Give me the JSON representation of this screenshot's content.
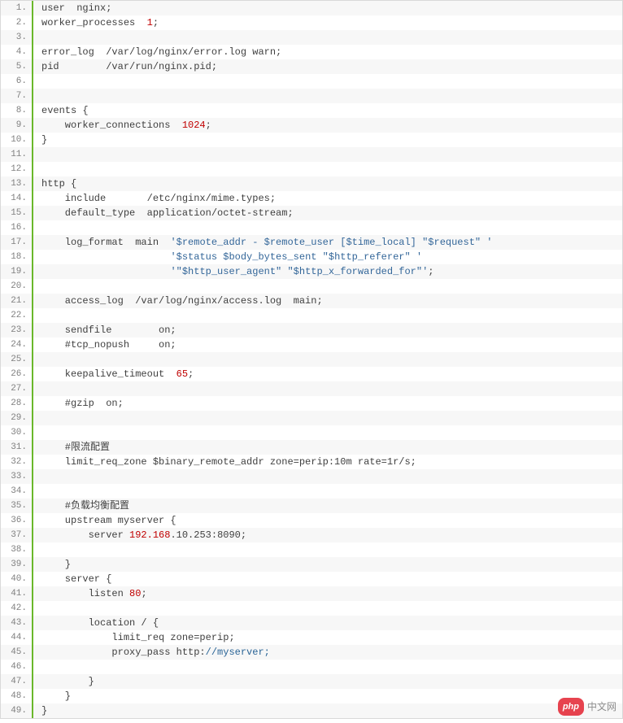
{
  "watermark": {
    "pill": "php",
    "text": "中文网"
  },
  "lines": [
    {
      "n": "1.",
      "segs": [
        [
          "",
          "user  nginx;"
        ]
      ]
    },
    {
      "n": "2.",
      "segs": [
        [
          "",
          "worker_processes  "
        ],
        [
          "num",
          "1"
        ],
        [
          "",
          ";"
        ]
      ]
    },
    {
      "n": "3.",
      "segs": []
    },
    {
      "n": "4.",
      "segs": [
        [
          "",
          "error_log  /var/log/nginx/error.log warn;"
        ]
      ]
    },
    {
      "n": "5.",
      "segs": [
        [
          "",
          "pid        /var/run/nginx.pid;"
        ]
      ]
    },
    {
      "n": "6.",
      "segs": []
    },
    {
      "n": "7.",
      "segs": []
    },
    {
      "n": "8.",
      "segs": [
        [
          "",
          "events {"
        ]
      ]
    },
    {
      "n": "9.",
      "segs": [
        [
          "",
          "    worker_connections  "
        ],
        [
          "num",
          "1024"
        ],
        [
          "",
          ";"
        ]
      ]
    },
    {
      "n": "10.",
      "segs": [
        [
          "",
          "}"
        ]
      ]
    },
    {
      "n": "11.",
      "segs": []
    },
    {
      "n": "12.",
      "segs": []
    },
    {
      "n": "13.",
      "segs": [
        [
          "",
          "http {"
        ]
      ]
    },
    {
      "n": "14.",
      "segs": [
        [
          "",
          "    include       /etc/nginx/mime.types;"
        ]
      ]
    },
    {
      "n": "15.",
      "segs": [
        [
          "",
          "    default_type  application/octet-stream;"
        ]
      ]
    },
    {
      "n": "16.",
      "segs": []
    },
    {
      "n": "17.",
      "segs": [
        [
          "",
          "    log_format  main  "
        ],
        [
          "str",
          "'$remote_addr - $remote_user [$time_local] \"$request\" '"
        ]
      ]
    },
    {
      "n": "18.",
      "segs": [
        [
          "",
          "                      "
        ],
        [
          "str",
          "'$status $body_bytes_sent \"$http_referer\" '"
        ]
      ]
    },
    {
      "n": "19.",
      "segs": [
        [
          "",
          "                      "
        ],
        [
          "str",
          "'\"$http_user_agent\" \"$http_x_forwarded_for\"'"
        ],
        [
          "",
          ";"
        ]
      ]
    },
    {
      "n": "20.",
      "segs": []
    },
    {
      "n": "21.",
      "segs": [
        [
          "",
          "    access_log  /var/log/nginx/access.log  main;"
        ]
      ]
    },
    {
      "n": "22.",
      "segs": []
    },
    {
      "n": "23.",
      "segs": [
        [
          "",
          "    sendfile        on;"
        ]
      ]
    },
    {
      "n": "24.",
      "segs": [
        [
          "",
          "    #tcp_nopush     on;"
        ]
      ]
    },
    {
      "n": "25.",
      "segs": []
    },
    {
      "n": "26.",
      "segs": [
        [
          "",
          "    keepalive_timeout  "
        ],
        [
          "num",
          "65"
        ],
        [
          "",
          ";"
        ]
      ]
    },
    {
      "n": "27.",
      "segs": []
    },
    {
      "n": "28.",
      "segs": [
        [
          "",
          "    #gzip  on;"
        ]
      ]
    },
    {
      "n": "29.",
      "segs": []
    },
    {
      "n": "30.",
      "segs": []
    },
    {
      "n": "31.",
      "segs": [
        [
          "",
          "    #限流配置"
        ]
      ]
    },
    {
      "n": "32.",
      "segs": [
        [
          "",
          "    limit_req_zone $binary_remote_addr zone=perip:10m rate=1r/s;"
        ]
      ]
    },
    {
      "n": "33.",
      "segs": []
    },
    {
      "n": "34.",
      "segs": []
    },
    {
      "n": "35.",
      "segs": [
        [
          "",
          "    #负载均衡配置"
        ]
      ]
    },
    {
      "n": "36.",
      "segs": [
        [
          "",
          "    upstream myserver {"
        ]
      ]
    },
    {
      "n": "37.",
      "segs": [
        [
          "",
          "        server "
        ],
        [
          "num",
          "192.168"
        ],
        [
          "",
          ".10.253:8090"
        ],
        [
          "",
          ";"
        ]
      ]
    },
    {
      "n": "38.",
      "segs": []
    },
    {
      "n": "39.",
      "segs": [
        [
          "",
          "    }"
        ]
      ]
    },
    {
      "n": "40.",
      "segs": [
        [
          "",
          "    server {"
        ]
      ]
    },
    {
      "n": "41.",
      "segs": [
        [
          "",
          "        listen "
        ],
        [
          "num",
          "80"
        ],
        [
          "",
          ";"
        ]
      ]
    },
    {
      "n": "42.",
      "segs": []
    },
    {
      "n": "43.",
      "segs": [
        [
          "",
          "        location / {"
        ]
      ]
    },
    {
      "n": "44.",
      "segs": [
        [
          "",
          "            limit_req zone=perip;"
        ]
      ]
    },
    {
      "n": "45.",
      "segs": [
        [
          "",
          "            proxy_pass http:"
        ],
        [
          "url",
          "//myserver;"
        ]
      ]
    },
    {
      "n": "46.",
      "segs": []
    },
    {
      "n": "47.",
      "segs": [
        [
          "",
          "        }"
        ]
      ]
    },
    {
      "n": "48.",
      "segs": [
        [
          "",
          "    }"
        ]
      ]
    },
    {
      "n": "49.",
      "segs": [
        [
          "",
          "}"
        ]
      ]
    }
  ]
}
